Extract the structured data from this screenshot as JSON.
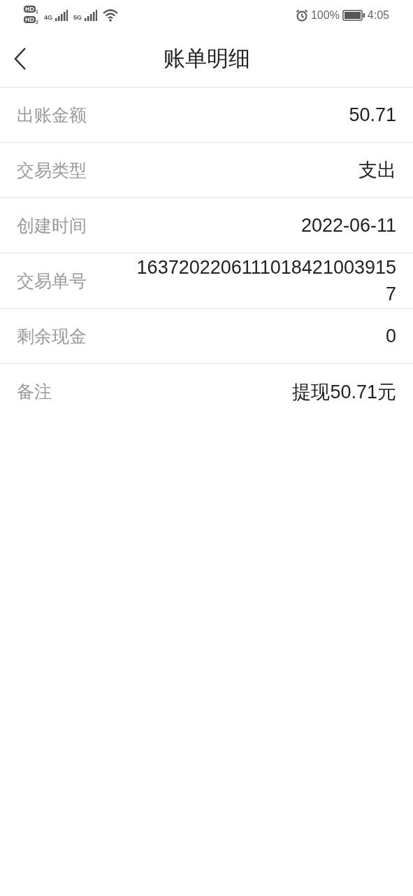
{
  "status_bar": {
    "sim_badges": [
      {
        "label": "HD",
        "slot": "1"
      },
      {
        "label": "HD",
        "slot": "2"
      }
    ],
    "networks": [
      "4G",
      "5G"
    ],
    "battery_percent": "100%",
    "time": "4:05"
  },
  "header": {
    "title": "账单明细"
  },
  "details": [
    {
      "label": "出账金额",
      "value": "50.71"
    },
    {
      "label": "交易类型",
      "value": "支出"
    },
    {
      "label": "创建时间",
      "value": "2022-06-11"
    },
    {
      "label": "交易单号",
      "value": "16372022061110184210039157"
    },
    {
      "label": "剩余现金",
      "value": "0"
    },
    {
      "label": "备注",
      "value": "提现50.71元"
    }
  ]
}
